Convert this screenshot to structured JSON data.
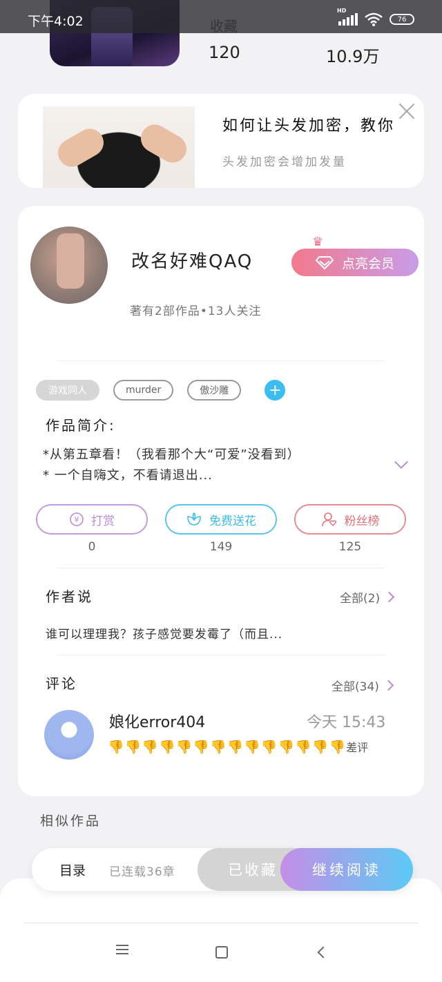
{
  "status_bar": {
    "time": "下午4:02",
    "battery": "76"
  },
  "book": {
    "stats": [
      {
        "label": "收藏",
        "value": "120"
      },
      {
        "label": "",
        "value": "10.9万"
      }
    ]
  },
  "ad": {
    "title": "如何让头发加密，教你",
    "subtitle": "头发加密会增加发量"
  },
  "author": {
    "name": "改名好难QAQ",
    "meta": "著有2部作品•13人关注",
    "vip_button": "点亮会员"
  },
  "tags": [
    "游戏同人",
    "murder",
    "傲沙雕"
  ],
  "intro": {
    "heading": "作品简介:",
    "line1": "*从第五章看！（我看那个大“可爱”没看到）",
    "line2": "* 一个自嗨文，不看请退出..."
  },
  "actions": [
    {
      "label": "打赏",
      "count": "0",
      "color": "#b98ad9"
    },
    {
      "label": "免费送花",
      "count": "149",
      "color": "#3cbde8"
    },
    {
      "label": "粉丝榜",
      "count": "125",
      "color": "#e4707a"
    }
  ],
  "author_says": {
    "heading": "作者说",
    "more": "全部(2)",
    "text": "谁可以理理我？孩子感觉要发霉了（而且..."
  },
  "comments": {
    "heading": "评论",
    "more": "全部(34)",
    "items": [
      {
        "user": "娘化error404",
        "time": "今天 15:43",
        "thumbs": "👎👎👎👎👎👎👎👎👎👎👎👎👎👎",
        "text": "差评"
      }
    ]
  },
  "similar": {
    "heading": "相似作品"
  },
  "read_bar": {
    "toc": "目录",
    "serial": "已连载36章",
    "collected": "已收藏",
    "continue": "继续阅读"
  }
}
